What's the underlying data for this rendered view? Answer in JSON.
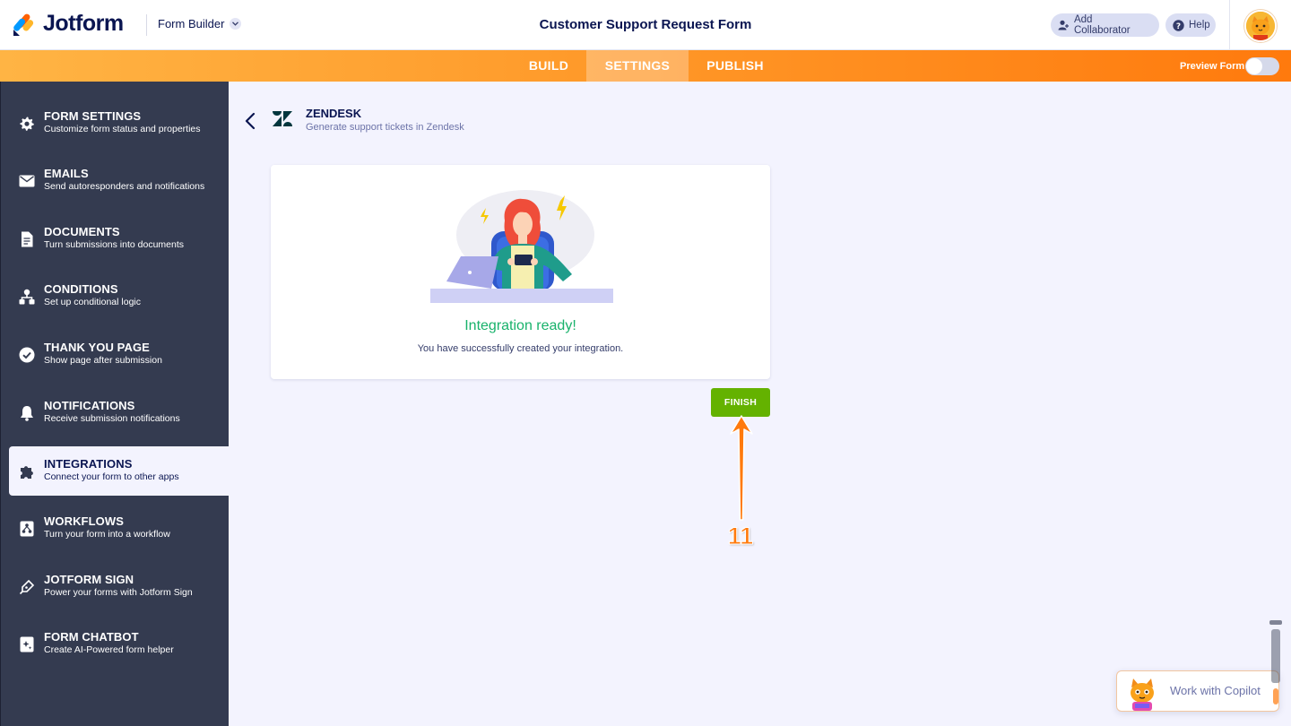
{
  "header": {
    "brand": "Jotform",
    "builder_label": "Form Builder",
    "form_title": "Customer Support Request Form",
    "collaborator_label": "Add Collaborator",
    "help_label": "Help"
  },
  "nav": {
    "tabs": [
      {
        "label": "BUILD",
        "active": false
      },
      {
        "label": "SETTINGS",
        "active": true
      },
      {
        "label": "PUBLISH",
        "active": false
      }
    ],
    "preview_label": "Preview Form",
    "preview_on": false
  },
  "sidebar": {
    "items": [
      {
        "title": "FORM SETTINGS",
        "subtitle": "Customize form status and properties",
        "icon": "gear-icon"
      },
      {
        "title": "EMAILS",
        "subtitle": "Send autoresponders and notifications",
        "icon": "envelope-icon"
      },
      {
        "title": "DOCUMENTS",
        "subtitle": "Turn submissions into documents",
        "icon": "document-icon"
      },
      {
        "title": "CONDITIONS",
        "subtitle": "Set up conditional logic",
        "icon": "hierarchy-icon"
      },
      {
        "title": "THANK YOU PAGE",
        "subtitle": "Show page after submission",
        "icon": "check-circle-icon"
      },
      {
        "title": "NOTIFICATIONS",
        "subtitle": "Receive submission notifications",
        "icon": "bell-icon"
      },
      {
        "title": "INTEGRATIONS",
        "subtitle": "Connect your form to other apps",
        "icon": "puzzle-icon",
        "active": true
      },
      {
        "title": "WORKFLOWS",
        "subtitle": "Turn your form into a workflow",
        "icon": "workflow-icon"
      },
      {
        "title": "JOTFORM SIGN",
        "subtitle": "Power your forms with Jotform Sign",
        "icon": "pen-nib-icon"
      },
      {
        "title": "FORM CHATBOT",
        "subtitle": "Create AI-Powered form helper",
        "icon": "chatbot-icon"
      }
    ]
  },
  "integration": {
    "name": "ZENDESK",
    "description": "Generate support tickets in Zendesk",
    "status_title": "Integration ready!",
    "status_message": "You have successfully created your integration.",
    "finish_label": "FINISH"
  },
  "annotation": {
    "step_number": "11"
  },
  "copilot": {
    "label": "Work with Copilot"
  },
  "colors": {
    "nav_orange": "#ff7a0d",
    "sidebar_bg": "#343b50",
    "success_green": "#18b26b",
    "finish_green": "#64b200",
    "brand_navy": "#0a1551"
  }
}
